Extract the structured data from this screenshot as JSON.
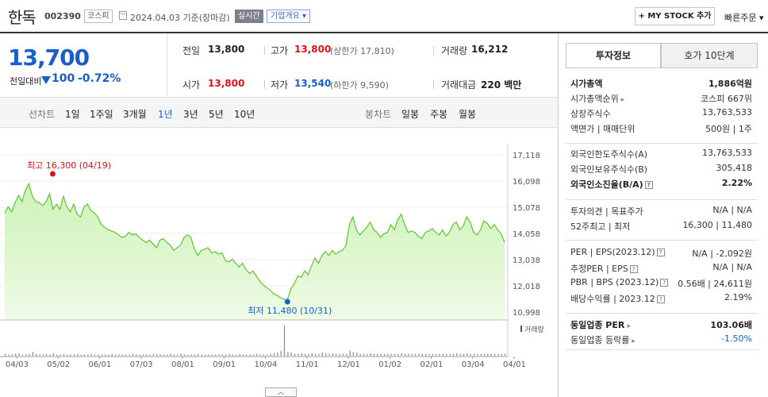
{
  "header": {
    "name": "한독",
    "code": "002390",
    "market": "코스피",
    "date_text": "2024.04.03  기준(장마감)",
    "realtime": "실시간",
    "overview": "기업개요 ▾",
    "mystock": "+ MY STOCK 추가",
    "quick_order": "빠른주문 ▾"
  },
  "quote": {
    "price": "13,700",
    "change_label": "전일대비",
    "change": "100",
    "change_pct": "-0.72%",
    "prev_close": {
      "label": "전일",
      "value": "13,800"
    },
    "high": {
      "label": "고가",
      "value": "13,800",
      "sub": "(상한가 17,810)"
    },
    "volume": {
      "label": "거래량",
      "value": "16,212"
    },
    "open": {
      "label": "시가",
      "value": "13,800"
    },
    "low": {
      "label": "저가",
      "value": "13,540",
      "sub": "(하한가 9,590)"
    },
    "amount": {
      "label": "거래대금",
      "value": "220 백만"
    }
  },
  "periods": {
    "line_label": "선차트",
    "line_items": [
      "1일",
      "1주일",
      "3개월",
      "1년",
      "3년",
      "5년",
      "10년"
    ],
    "selected": "1년",
    "candle_label": "봉차트",
    "candle_items": [
      "일봉",
      "주봉",
      "월봉"
    ]
  },
  "chart_data": {
    "type": "area",
    "y_ticks": [
      "17,118",
      "16,098",
      "15,078",
      "14,058",
      "13,038",
      "12,018",
      "10,998"
    ],
    "ylim": [
      10998,
      17118
    ],
    "x_ticks": [
      "04/03",
      "05/02",
      "06/01",
      "07/03",
      "08/01",
      "09/01",
      "10/04",
      "11/01",
      "12/01",
      "01/02",
      "02/01",
      "03/04",
      "04/01"
    ],
    "high_label": "최고 16,300 (04/19)",
    "low_label": "최저 11,480 (10/31)",
    "volume_legend": "거래량",
    "series": [
      {
        "values": [
          14850,
          15100,
          14900,
          15250,
          15550,
          15300,
          15750,
          16000,
          15500,
          15300,
          15250,
          15150,
          15300,
          15600,
          15000,
          15200,
          15000,
          15500,
          15100,
          14900,
          15200,
          14800,
          14700,
          15100,
          15200,
          14950,
          14850,
          14700,
          14400,
          14300,
          14200,
          14150,
          14100,
          14000,
          13900,
          13950,
          14100,
          14000,
          14050,
          13900,
          13800,
          13700,
          13800,
          13650,
          13500,
          13800,
          13850,
          13700,
          13600,
          13400,
          13500,
          13600,
          13900,
          14000,
          13900,
          13450,
          13200,
          13400,
          13450,
          13500,
          13300,
          13350,
          13250,
          13300,
          13000,
          12950,
          13050,
          12900,
          12750,
          12900,
          12650,
          12500,
          12600,
          12400,
          12200,
          12050,
          11950,
          11850,
          11700,
          11650,
          11550,
          11500,
          11480,
          11900,
          12100,
          12400,
          12350,
          12600,
          12450,
          12800,
          13100,
          12900,
          13200,
          13350,
          13200,
          13400,
          13250,
          13350,
          13400,
          13600,
          14400,
          14700,
          14200,
          14000,
          14150,
          14300,
          14500,
          14200,
          14100,
          13900,
          14050,
          14100,
          14400,
          14200,
          14600,
          14800,
          14400,
          14100,
          14150,
          14100,
          13950,
          13850,
          14100,
          14150,
          14250,
          14100,
          14000,
          14200,
          13950,
          14100,
          14400,
          14500,
          14200,
          14350,
          14700,
          14500,
          14100,
          14000,
          14200,
          14550,
          14450,
          14250,
          14400,
          14200,
          14050,
          13700
        ]
      }
    ],
    "volume": [
      3,
      2,
      2,
      3,
      4,
      2,
      2,
      3,
      6,
      3,
      2,
      2,
      3,
      2,
      4,
      2,
      2,
      3,
      2,
      2,
      2,
      3,
      2,
      2,
      2,
      3,
      2,
      2,
      2,
      2,
      2,
      3,
      2,
      2,
      2,
      2,
      2,
      3,
      2,
      2,
      2,
      2,
      2,
      3,
      2,
      2,
      2,
      2,
      3,
      2,
      2,
      3,
      2,
      2,
      2,
      2,
      3,
      2,
      2,
      2,
      2,
      2,
      2,
      2,
      2,
      3,
      2,
      2,
      3,
      2,
      2,
      2,
      2,
      3,
      2,
      2,
      2,
      3,
      4,
      5,
      8,
      48,
      6,
      5,
      3,
      3,
      4,
      3,
      3,
      4,
      3,
      3,
      5,
      4,
      3,
      4,
      3,
      3,
      3,
      3,
      8,
      6,
      5,
      3,
      3,
      3,
      4,
      3,
      3,
      3,
      3,
      3,
      3,
      3,
      3,
      4,
      3,
      3,
      3,
      3,
      3,
      3,
      3,
      3,
      3,
      3,
      3,
      3,
      3,
      3,
      3,
      4,
      3,
      3,
      4,
      3,
      3,
      3,
      3,
      3,
      3,
      3,
      3,
      3,
      3,
      3
    ]
  },
  "invest": {
    "tab_active": "투자정보",
    "tab_other": "호가 10단계",
    "rows_a": [
      {
        "label": "시가총액",
        "value": "1,886억원",
        "bold": true
      },
      {
        "label": "시가총액순위",
        "value": "코스피 667위",
        "arrow": true
      },
      {
        "label": "상장주식수",
        "value": "13,763,533"
      },
      {
        "label": "액면가 | 매매단위",
        "value": "500원 | 1주"
      }
    ],
    "rows_b": [
      {
        "label": "외국인한도주식수(A)",
        "value": "13,763,533"
      },
      {
        "label": "외국인보유주식수(B)",
        "value": "305,418"
      },
      {
        "label": "외국인소진율(B/A)",
        "value": "2.22%",
        "bold": true,
        "q": true
      }
    ],
    "rows_c": [
      {
        "label": "투자의견 | 목표주가",
        "value": "N/A | N/A"
      },
      {
        "label": "52주최고 | 최저",
        "value": "16,300 | 11,480"
      }
    ],
    "rows_d": [
      {
        "label": "PER | EPS(2023.12)",
        "value": "N/A | -2,092원",
        "q": true
      },
      {
        "label": "추정PER | EPS",
        "value": "N/A | N/A",
        "q": true
      },
      {
        "label": "PBR | BPS (2023.12)",
        "value": "0.56배 | 24,611원",
        "q": true
      },
      {
        "label": "배당수익률 | 2023.12",
        "value": "2.19%",
        "q": true
      }
    ],
    "rows_e": [
      {
        "label": "동일업종 PER",
        "value": "103.06배",
        "bold": true,
        "arrow": true
      },
      {
        "label": "동일업종 등락률",
        "value": "-1.50%",
        "blue": true,
        "arrow": true
      }
    ]
  }
}
